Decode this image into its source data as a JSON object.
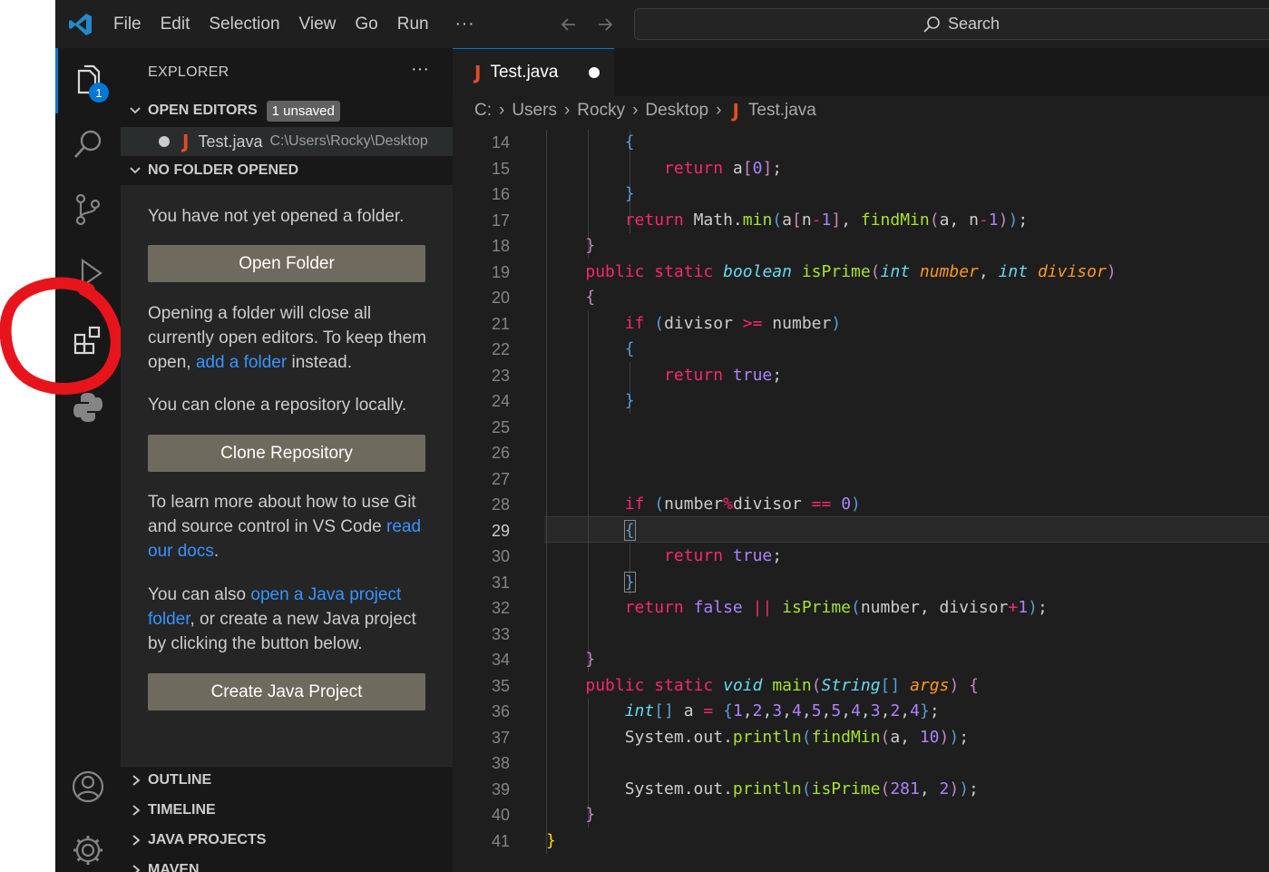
{
  "menu": {
    "items": [
      "File",
      "Edit",
      "Selection",
      "View",
      "Go",
      "Run"
    ],
    "more": "···",
    "search_label": "Search"
  },
  "activity": {
    "explorer_badge": "1"
  },
  "sidebar": {
    "title": "EXPLORER",
    "more": "···",
    "open_editors": {
      "label": "OPEN EDITORS",
      "badge": "1 unsaved",
      "file_name": "Test.java",
      "file_path": "C:\\Users\\Rocky\\Desktop"
    },
    "no_folder": {
      "label": "NO FOLDER OPENED",
      "text1": "You have not yet opened a folder.",
      "open_folder_button": "Open Folder",
      "text2_a": "Opening a folder will close all currently open editors. To keep them open, ",
      "text2_link": "add a folder",
      "text2_b": " instead.",
      "text3": "You can clone a repository locally.",
      "clone_button": "Clone Repository",
      "text4_a": "To learn more about how to use Git and source control in VS Code ",
      "text4_link": "read our docs",
      "text4_b": ".",
      "text5_a": "You can also ",
      "text5_link": "open a Java project folder",
      "text5_b": ", or create a new Java project by clicking the button below.",
      "create_button": "Create Java Project"
    },
    "bottom_sections": [
      "OUTLINE",
      "TIMELINE",
      "JAVA PROJECTS",
      "MAVEN"
    ]
  },
  "editor": {
    "tab_label": "Test.java",
    "breadcrumb": [
      "C:",
      "Users",
      "Rocky",
      "Desktop",
      "Test.java"
    ],
    "current_line": "29",
    "line_numbers": [
      "14",
      "15",
      "16",
      "17",
      "18",
      "19",
      "20",
      "21",
      "22",
      "23",
      "24",
      "25",
      "26",
      "27",
      "28",
      "29",
      "30",
      "31",
      "32",
      "33",
      "34",
      "35",
      "36",
      "37",
      "38",
      "39",
      "40",
      "41"
    ]
  },
  "colors": {
    "accent": "#0078d4",
    "link": "#3794ff",
    "button_bg": "#6f6a5e",
    "annotation": "#e8141c"
  }
}
